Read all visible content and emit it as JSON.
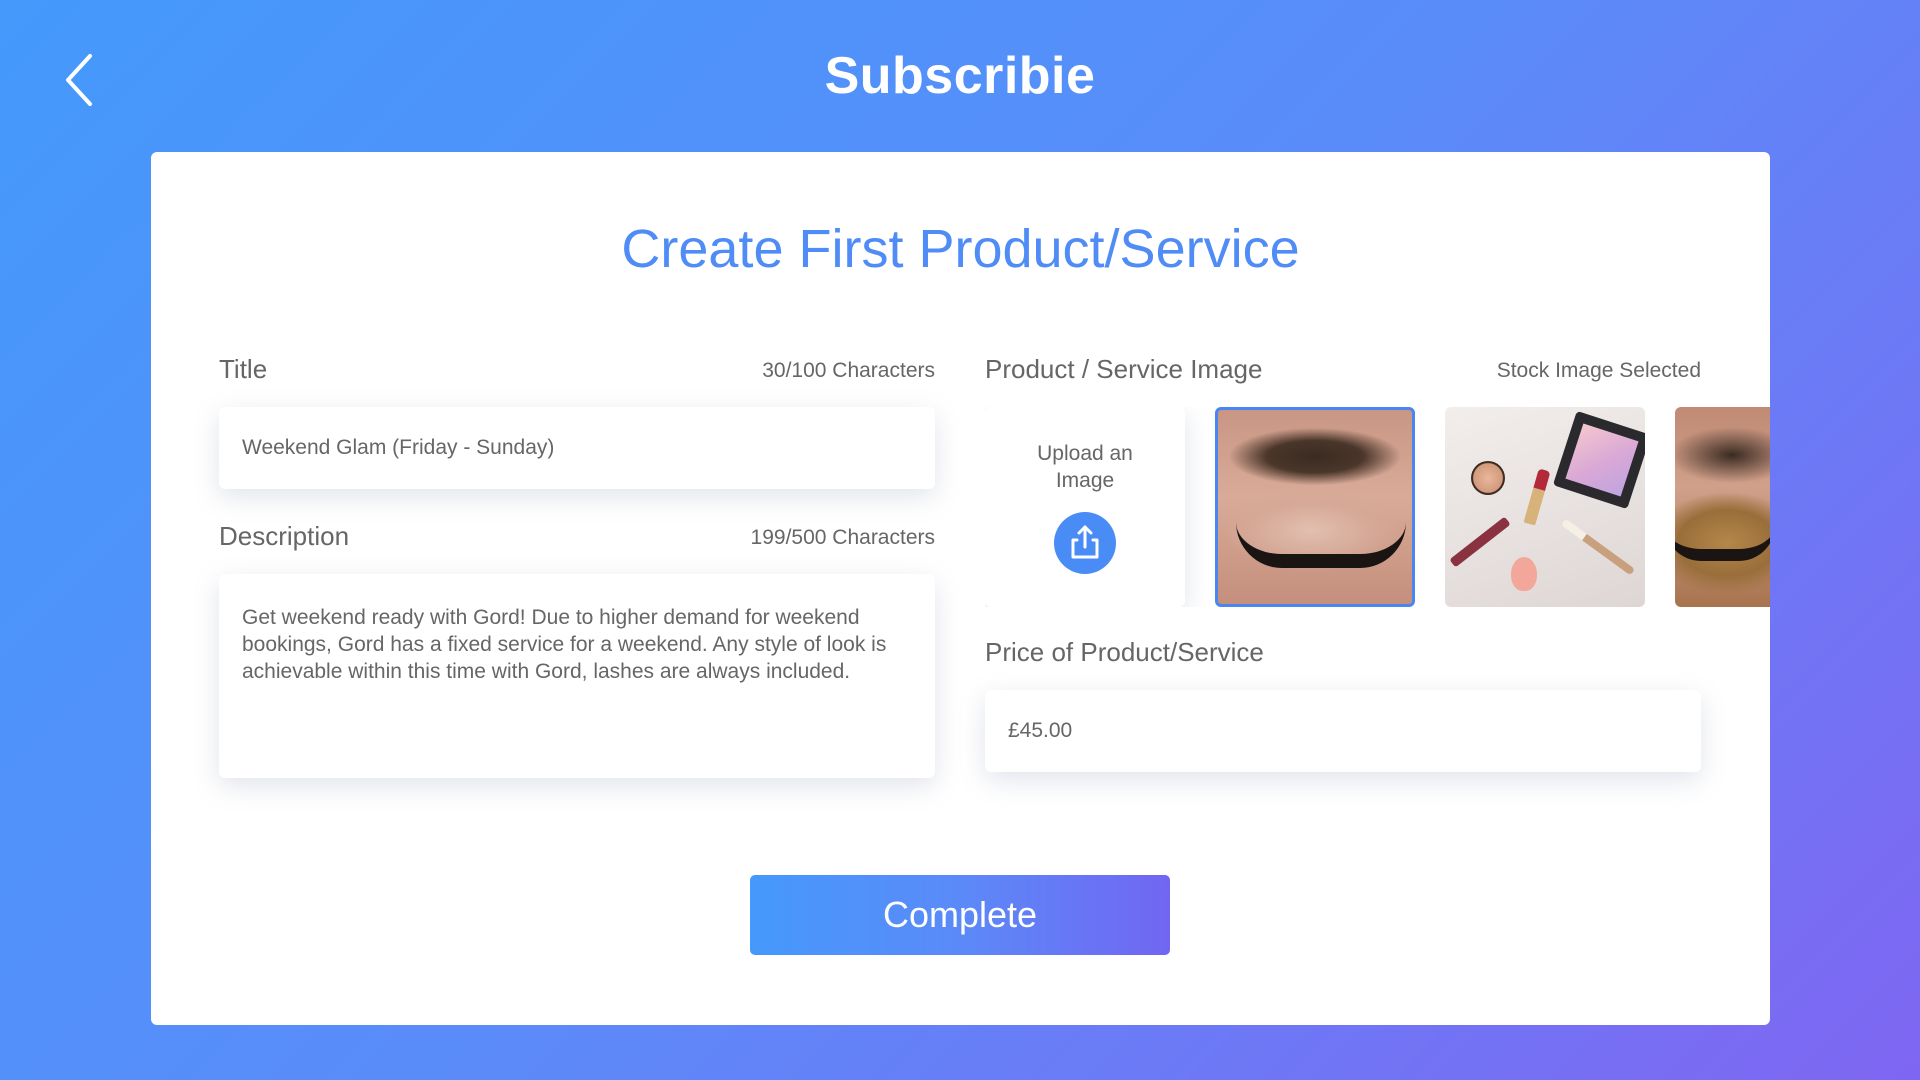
{
  "header": {
    "app_title": "Subscribie",
    "back_icon": "chevron-left-icon"
  },
  "form": {
    "heading": "Create First Product/Service",
    "title": {
      "label": "Title",
      "counter": "30/100 Characters",
      "value": "Weekend Glam (Friday - Sunday)"
    },
    "description": {
      "label": "Description",
      "counter": "199/500 Characters",
      "value": "Get weekend ready with Gord! Due to higher demand for weekend bookings, Gord has a fixed service for a weekend. Any style of look is achievable within this time with Gord, lashes are always included."
    },
    "image": {
      "label": "Product / Service Image",
      "status": "Stock Image Selected",
      "upload_text": "Upload an Image",
      "upload_icon": "share-upload-icon",
      "selected_index": 0,
      "stock_images": [
        {
          "subject": "eye-makeup-closeup"
        },
        {
          "subject": "makeup-products-flatlay"
        },
        {
          "subject": "glitter-eye-makeup"
        }
      ]
    },
    "price": {
      "label": "Price of Product/Service",
      "value": "£45.00"
    },
    "complete_label": "Complete"
  },
  "colors": {
    "accent": "#4f8cf6",
    "gradient_start": "#4499fb",
    "gradient_end": "#7f66f2",
    "selected_border": "#4a86f0"
  }
}
